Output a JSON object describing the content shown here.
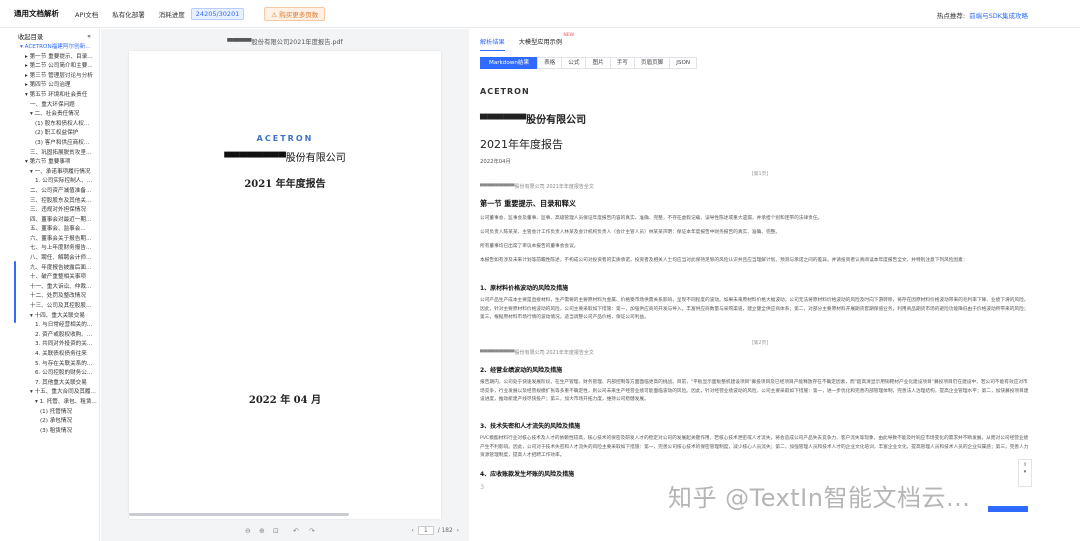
{
  "topbar": {
    "brand": "通用文档解析",
    "nav": [
      "API文档",
      "私有化部署",
      "消耗进度"
    ],
    "quota": "24205/30201",
    "warning": "购买更多页数",
    "hot_label": "热点推荐:",
    "hot_link": "前端与SDK集成攻略"
  },
  "sidebar": {
    "title": "收起目录",
    "collapse_icon": "double-chevron-left-icon",
    "items": [
      {
        "label": "▾ ACETRON福建阿尔创新...",
        "level": 0,
        "active": true
      },
      {
        "label": "▸ 第一节 重要提示、目录...",
        "level": 1
      },
      {
        "label": "▸ 第二节 公司简介和主要...",
        "level": 1
      },
      {
        "label": "▸ 第三节 管理层讨论与分析",
        "level": 1
      },
      {
        "label": "▸ 第四节 公司治理",
        "level": 1
      },
      {
        "label": "▾ 第五节 环境和社会责任",
        "level": 1
      },
      {
        "label": "一、重大环保问题",
        "level": 2
      },
      {
        "label": "▾ 二、社会责任情况",
        "level": 2
      },
      {
        "label": "(1) 股东和债权人权...",
        "level": 3
      },
      {
        "label": "(2) 职工权益保护",
        "level": 3
      },
      {
        "label": "(3) 客户和供应商权...",
        "level": 3
      },
      {
        "label": "三、巩固拓展脱贫攻坚...",
        "level": 2
      },
      {
        "label": "▾ 第六节 重要事项",
        "level": 1
      },
      {
        "label": "▾ 一、承诺事项履行情况",
        "level": 2
      },
      {
        "label": "1. 公司实际控制人、...",
        "level": 3
      },
      {
        "label": "二、公司资产减值准备...",
        "level": 2
      },
      {
        "label": "三、控股股东及其他关...",
        "level": 2
      },
      {
        "label": "三、违规对外担保情况",
        "level": 2
      },
      {
        "label": "四、董事会对最近一期...",
        "level": 2
      },
      {
        "label": "五、董事会、监事会...",
        "level": 2
      },
      {
        "label": "六、董事会关于报告期...",
        "level": 2
      },
      {
        "label": "七、与上年度财务报告...",
        "level": 2
      },
      {
        "label": "八、聘任、解聘会计师...",
        "level": 2
      },
      {
        "label": "九、年度报告披露后面...",
        "level": 2
      },
      {
        "label": "十、破产重整相关事项",
        "level": 2
      },
      {
        "label": "十一、重大诉讼、仲裁...",
        "level": 2
      },
      {
        "label": "十二、处罚及整改情况",
        "level": 2
      },
      {
        "label": "十三、公司及其控股股...",
        "level": 2
      },
      {
        "label": "▾ 十四、重大关联交易",
        "level": 2
      },
      {
        "label": "1. 与日常经营相关的...",
        "level": 3
      },
      {
        "label": "2. 资产或股权收购、...",
        "level": 3
      },
      {
        "label": "3. 共同对外投资的关...",
        "level": 3
      },
      {
        "label": "4. 关联债权债务往来",
        "level": 3
      },
      {
        "label": "5. 与存在关联关系的...",
        "level": 3
      },
      {
        "label": "6. 公司控股的财务公...",
        "level": 3
      },
      {
        "label": "7. 其他重大关联交易",
        "level": 3
      },
      {
        "label": "▾ 十五、重大合同及其履...",
        "level": 2
      },
      {
        "label": "▾ 1. 托管、承包、租赁...",
        "level": 3
      },
      {
        "label": "(1) 托管情况",
        "level": 4
      },
      {
        "label": "(2) 承包情况",
        "level": 4
      },
      {
        "label": "(3) 租赁情况",
        "level": 4
      }
    ]
  },
  "pdf": {
    "filename": "▀▀▀▀▀股份有限公司2021年度报告.pdf",
    "logo": "ACETRON",
    "company": "▀▀▀▀▀▀▀▀股份有限公司",
    "report": "2021 年年度报告",
    "date": "2022 年 04 月",
    "page_current": "1",
    "page_total": "/ 182",
    "tools": [
      "zoom-out-icon",
      "zoom-in-icon",
      "fit-icon",
      "rotate-left-icon",
      "rotate-right-icon"
    ]
  },
  "result": {
    "tabs": [
      {
        "label": "解析结果",
        "active": true
      },
      {
        "label": "大模型应用示例",
        "badge": "NEW"
      }
    ],
    "subtabs": [
      "Markdown结果",
      "表格",
      "公式",
      "图片",
      "手写",
      "页眉页脚",
      "JSON"
    ],
    "doc": {
      "logo": "ACETRON",
      "company": "▀▀▀▀▀▀股份有限公司",
      "report": "2021年年度报告",
      "date": "2022年04月",
      "page1": "[第1页]",
      "page2": "[第2页]",
      "running_header": "▀▀▀▀▀▀▀▀▀股份有限公司 2021年年度报告全文",
      "s1": "第一节 重要提示、目录和释义",
      "p1": "公司董事会、监事会及董事、监事、高级管理人员保证年度报告内容的真实、准确、完整，不存在虚假记载、误导性陈述或重大遗漏，并承担个别和连带的法律责任。",
      "p2": "公司负责人陈某某、主管会计工作负责人林某及会计机构负责人（会计主管人员）林某某声明：保证本年度报告中财务报告的真实、准确、完整。",
      "p3": "所有董事均已出席了审议本报告的董事会会议。",
      "p4": "本报告如有涉及未来计划等前瞻性陈述，不构成公司对投资者的实质承诺，投资者及相关人士均应当对此保持足够的风险认识并且应当理解计划、预测与承诺之间的差异。并请投资者认真阅读本年度报告全文，并特别注意下列风险因素：",
      "h1": "1、原材料价格波动的风险及措施",
      "p5": "公司产品生产成本主要是直接材料，生产需要的主要原材料为金属、价格受市场供需关系影响，呈现不同程度的波动。如果未来原材料价格大幅波动，公司无法将原材料价格波动的风险及时向下游转移，将存在因原材料价格波动带来的毛利率下降、业绩下滑的风险。因此，针对主要原材料价格波动的风险，公司主要采取如下措施：第一，加强供应商的开发与导入，丰富供应商数量与采购渠道，建立健全供应商体系；第二，对部分主要原材料开展期货套期保值业务，利用商品期货市场的避险功能降低由于价格波动所带来的风险；第三，根据原材料市场行情的波动情况，适当调整公司产品价格，保证公司利益。",
      "h2": "2、经营业绩波动的风险及措施",
      "p6": "报告期内，公司处于快速发展阶段，在生产管理、财务管理、内部控制等方面面临更高的挑战。目前，\"平板显示面板整机建设项目\"募投项目及已经项目产能释放存在不确定因素，而\"超高清显示用铜靶材产业化建设项目\"募投项目仍在建设中，若公司不能有效应对市场竞争，行业发展以及经营规模扩张等多重不确定性，则公司未来生产经营业绩可能面临波动的风险。因此，针对经营业绩波动的风险，公司主要采取如下措施：第一，进一步优化和完善内部管理体制，完善法人治理结构，提高企业管理水平；第二，加快募投项目建设进度，推动新建产线尽快投产；第三，加大市场开拓力度，维持公司稳健发展。",
      "h3": "3、技术失密和人才流失的风险及措施",
      "p7": "PVC模酯材料行业对核心技术及人才的依赖性较高，核心技术的保密及研发人才的稳定对公司的发展起关键作用，若核心技术泄密或人才流失，将会造成公司产品失去竞争力、客户流失等现象，由此导致不能及时响应市场变化的需求并不断发展。从而对公司经营业绩产生不利影响。因此，公司对于技术失密和人才流失的风险主要采取如下措施：第一，完善公司核心技术的保密管理制度，减少核心人员流失；第二，加强管理人员和技术人才的企业文化培训，丰富企业文化，提高管理人员和技术人员的企业归属感；第三，完善人力资源管理制度，提高人才招聘工作效率。",
      "h4": "4、应收账款发生坏账的风险及措施",
      "tail": "3"
    },
    "float_icon": "share-icon"
  },
  "watermark": "知乎 @TextIn智能文档云..."
}
